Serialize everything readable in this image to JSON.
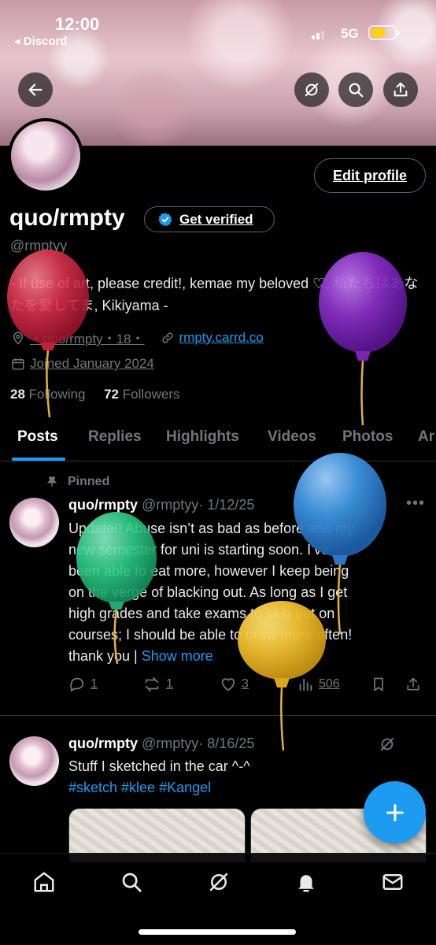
{
  "status_bar": {
    "time": "12:00",
    "back_app": "◂ Discord",
    "network": "5G"
  },
  "header": {
    "edit_profile_label": "Edit profile"
  },
  "profile": {
    "name": "quo/rmpty",
    "verify_label": "Get verified",
    "handle": "@rmptyy",
    "bio": "- If use of art, please credit!, kemae my beloved ♡, 私たちはあなたを愛してま, Kikiyama -",
    "location": "・quo/rmpty・18・",
    "website": "rmpty.carrd.co",
    "joined": "Joined January 2024",
    "following_count": "28",
    "following_label": "Following",
    "followers_count": "72",
    "followers_label": "Followers"
  },
  "tabs": [
    {
      "label": "Posts"
    },
    {
      "label": "Replies"
    },
    {
      "label": "Highlights"
    },
    {
      "label": "Videos"
    },
    {
      "label": "Photos"
    },
    {
      "label": "Ar"
    }
  ],
  "posts": [
    {
      "pinned_label": "Pinned",
      "name": "quo/rmpty",
      "handle": "@rmptyy",
      "date": "· 1/12/25",
      "lines": [
        "Update!! Abuse isn’t as bad as before and my",
        "new semester for uni is starting soon. I’ve",
        "been able to eat more, however I keep being",
        "on the verge of blacking out. As long as I get",
        "high grades and take exams to skip out on",
        "courses; I should be able to draw more often!",
        "thank you |"
      ],
      "show_more": "Show more",
      "replies": "1",
      "reposts": "1",
      "likes": "3",
      "views": "506"
    },
    {
      "name": "quo/rmpty",
      "handle": "@rmptyy",
      "date": "· 8/16/25",
      "text": "Stuff I sketched in the car ^-^",
      "tags": "#sketch #klee #Kangel"
    }
  ],
  "icons": {
    "back": "arrow-left-icon",
    "grok": "grok-icon",
    "search": "search-icon",
    "share": "share-icon",
    "compose": "plus-icon",
    "nav": [
      "home-icon",
      "search-icon",
      "grok-icon",
      "bell-icon",
      "mail-icon"
    ]
  },
  "colors": {
    "accent": "#1d9bf0",
    "balloons": [
      "#e0334f",
      "#8b2fc9",
      "#3d94e0",
      "#2fcf8a",
      "#f0c030"
    ]
  }
}
